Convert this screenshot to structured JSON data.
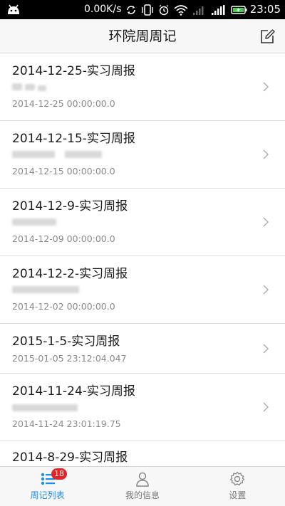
{
  "status_bar": {
    "net_speed": "0.00K/s",
    "time": "23:05",
    "icons": [
      "android-icon",
      "sync-icon",
      "vibrate-icon",
      "alarm-icon",
      "wifi-icon",
      "signal-icon",
      "signal-4g-icon",
      "battery-charging-icon"
    ]
  },
  "header": {
    "title": "环院周周记",
    "compose_icon": "compose-icon"
  },
  "reports": [
    {
      "title": "2014-12-25-实习周报",
      "time": "2014-12-25 00:00:00.0",
      "has_preview": true
    },
    {
      "title": "2014-12-15-实习周报",
      "time": "2014-12-15 00:00:00.0",
      "has_preview": true
    },
    {
      "title": "2014-12-9-实习周报",
      "time": "2014-12-09 00:00:00.0",
      "has_preview": true
    },
    {
      "title": "2014-12-2-实习周报",
      "time": "2014-12-02 00:00:00.0",
      "has_preview": true
    },
    {
      "title": "2015-1-5-实习周报",
      "time": "2015-01-05 23:12:04.047",
      "has_preview": false
    },
    {
      "title": "2014-11-24-实习周报",
      "time": "2014-11-24 23:01:19.75",
      "has_preview": true
    },
    {
      "title": "2014-8-29-实习周报",
      "time": "",
      "has_preview": false
    }
  ],
  "tabbar": {
    "tabs": [
      {
        "label": "周记列表",
        "icon": "list-icon",
        "active": true,
        "badge": "18"
      },
      {
        "label": "我的信息",
        "icon": "user-icon",
        "active": false
      },
      {
        "label": "设置",
        "icon": "gear-icon",
        "active": false
      }
    ]
  },
  "colors": {
    "accent": "#1f8ee0",
    "badge": "#e62222",
    "status_bar": "#000000",
    "header_bg": "#f7f7f7"
  }
}
